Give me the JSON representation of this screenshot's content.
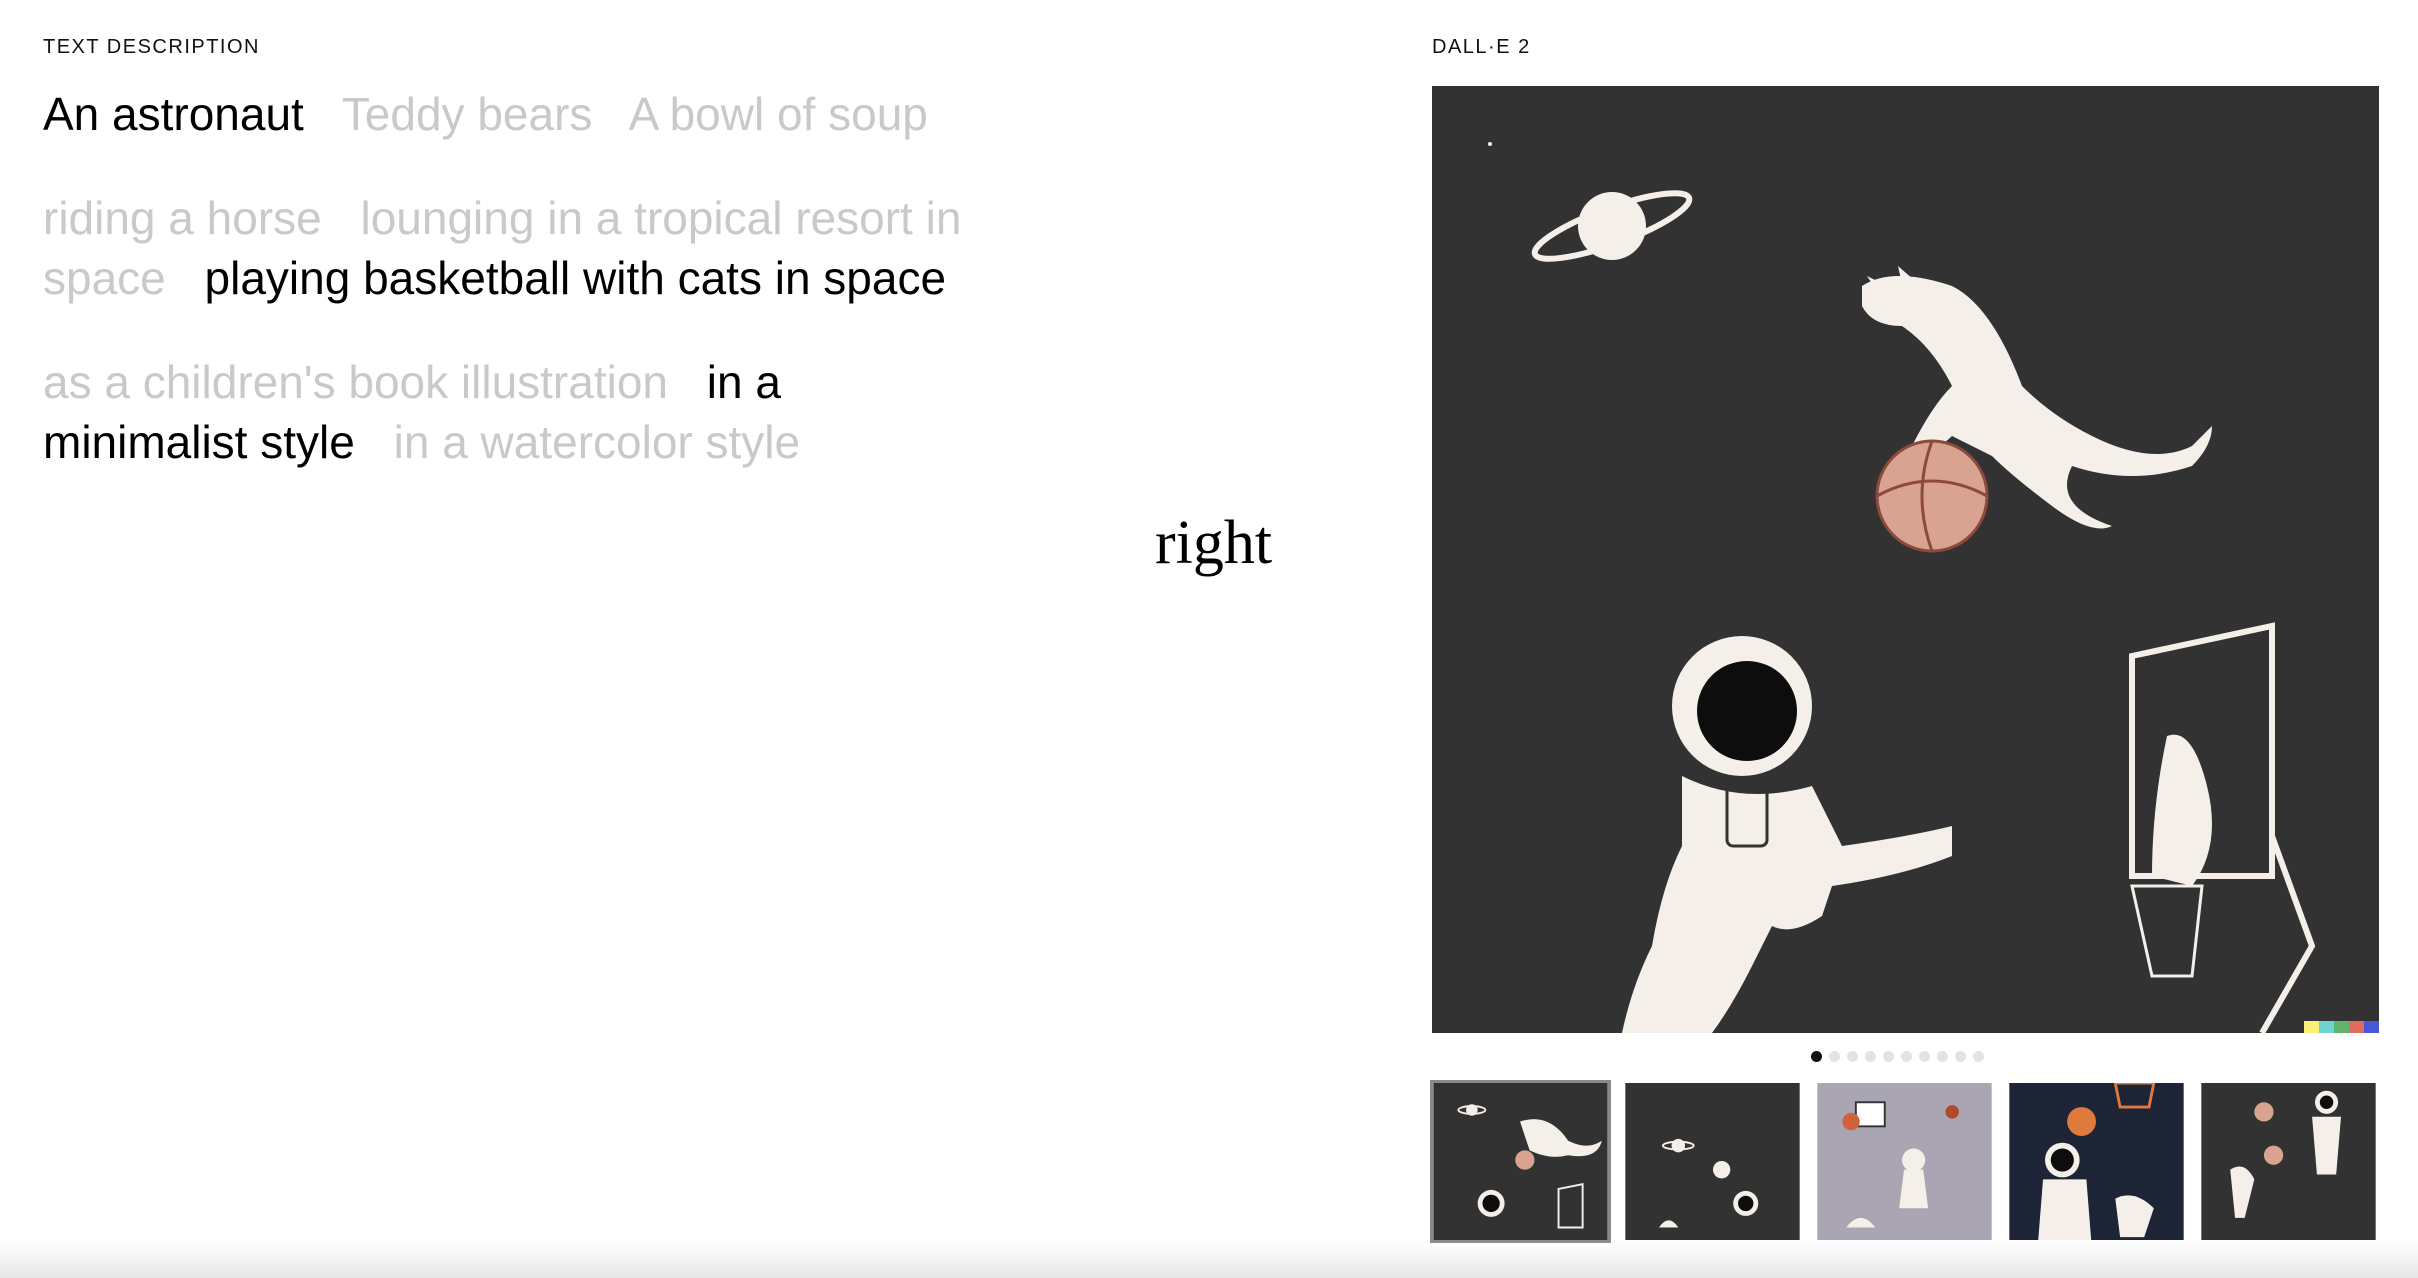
{
  "left_panel": {
    "label": "TEXT DESCRIPTION",
    "subjects": [
      {
        "text": "An astronaut",
        "selected": true
      },
      {
        "text": "Teddy bears",
        "selected": false
      },
      {
        "text": "A bowl of soup",
        "selected": false
      }
    ],
    "activities": [
      {
        "text": "riding a horse",
        "selected": false
      },
      {
        "text": "lounging in a tropical resort in space",
        "selected": false
      },
      {
        "text": "playing basketball with cats in space",
        "selected": true
      }
    ],
    "styles": [
      {
        "text": "as a children's book illustration",
        "selected": false
      },
      {
        "text": "in a minimalist style",
        "selected": true
      },
      {
        "text": "in a watercolor style",
        "selected": false
      }
    ]
  },
  "center_word": "right",
  "right_panel": {
    "label": "DALL·E 2",
    "main_image_alt": "astronaut playing basketball with cats in space minimalist illustration",
    "carousel": {
      "total": 10,
      "active_index": 0
    },
    "thumbnails": [
      {
        "name": "thumbnail-1",
        "selected": true
      },
      {
        "name": "thumbnail-2",
        "selected": false
      },
      {
        "name": "thumbnail-3",
        "selected": false
      },
      {
        "name": "thumbnail-4",
        "selected": false
      },
      {
        "name": "thumbnail-5",
        "selected": false
      }
    ]
  },
  "colors": {
    "selected_text": "#000000",
    "unselected_text": "#c9c9c9",
    "image_background": "#323232",
    "basketball": "#d9a392"
  }
}
